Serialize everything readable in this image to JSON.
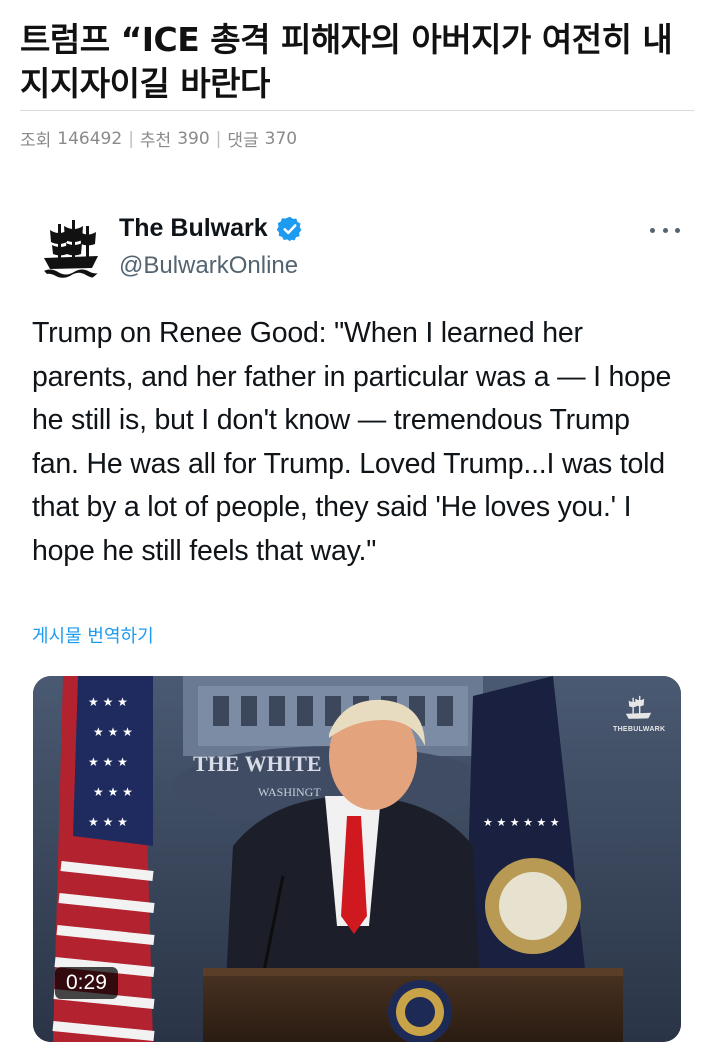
{
  "article": {
    "title": "트럼프 “ICE 총격 피해자의 아버지가 여전히 내 지지자이길 바란다",
    "meta": {
      "views_label": "조회",
      "views": "146492",
      "recommend_label": "추천",
      "recommend": "390",
      "comments_label": "댓글",
      "comments": "370"
    }
  },
  "tweet": {
    "author_name": "The Bulwark",
    "handle": "@BulwarkOnline",
    "verified": true,
    "text": "Trump on Renee Good: \"When I learned her parents, and her father in particular was a — I hope he still is, but I don't know — tremendous Trump fan. He was all for Trump. Loved Trump...I was told that by a lot of people, they said 'He loves you.' I hope he still feels that way.\"",
    "translate_label": "게시물 번역하기",
    "video": {
      "duration": "0:29",
      "watermark": "THEBULWARK",
      "backdrop_text_1": "THE WHITE",
      "backdrop_text_2": "WASHINGT"
    }
  },
  "colors": {
    "accent": "#1d9bf0",
    "text_primary": "#0f1419",
    "text_secondary": "#536471",
    "meta_gray": "#8a8a8a"
  },
  "icons": [
    "ship-logo-icon",
    "verified-badge-icon",
    "more-options-icon"
  ]
}
